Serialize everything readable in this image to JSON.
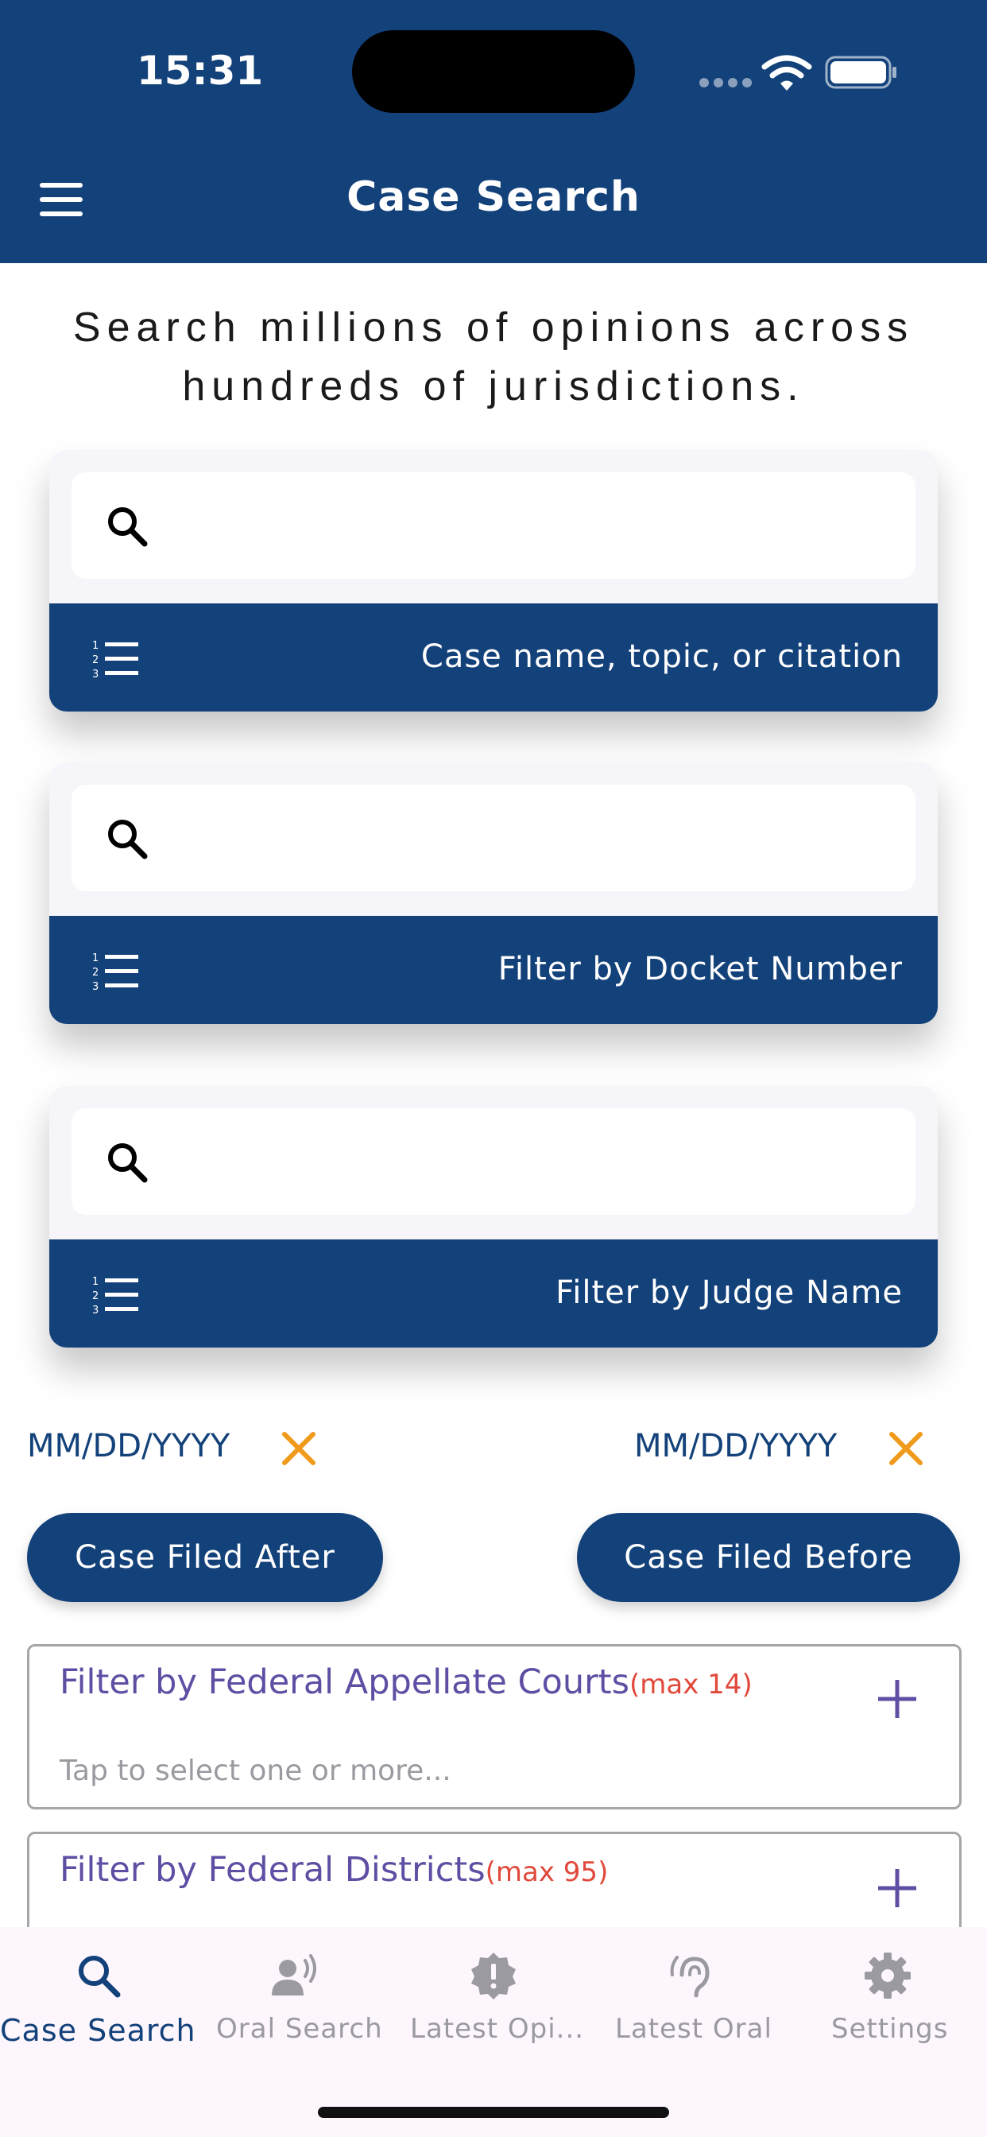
{
  "status_bar": {
    "time": "15:31"
  },
  "header": {
    "title": "Case Search"
  },
  "tagline": "Search millions of opinions across hundreds of jurisdictions.",
  "search_cards": [
    {
      "label": "Case name, topic, or citation",
      "value": ""
    },
    {
      "label": "Filter by Docket Number",
      "value": ""
    },
    {
      "label": "Filter by Judge Name",
      "value": ""
    }
  ],
  "dates": {
    "after": {
      "value": "MM/DD/YYYY",
      "button": "Case Filed After"
    },
    "before": {
      "value": "MM/DD/YYYY",
      "button": "Case Filed Before"
    }
  },
  "filters": [
    {
      "title": "Filter by Federal Appellate Courts",
      "max": "(max 14)",
      "hint": "Tap to select one or more..."
    },
    {
      "title": "Filter by Federal Districts",
      "max": "(max 95)",
      "hint": ""
    }
  ],
  "tabs": [
    {
      "label": "Case Search",
      "icon": "search-icon",
      "active": true
    },
    {
      "label": "Oral Search",
      "icon": "speaking-person-icon",
      "active": false
    },
    {
      "label": "Latest Opi...",
      "icon": "alert-badge-icon",
      "active": false
    },
    {
      "label": "Latest Oral",
      "icon": "hearing-icon",
      "active": false
    },
    {
      "label": "Settings",
      "icon": "gear-icon",
      "active": false
    }
  ],
  "colors": {
    "primary": "#13417a",
    "accent_orange": "#f09a1c",
    "filter_title": "#5f4ea3",
    "max_red": "#e0493b",
    "tab_bar_bg": "#fdf6fd"
  }
}
